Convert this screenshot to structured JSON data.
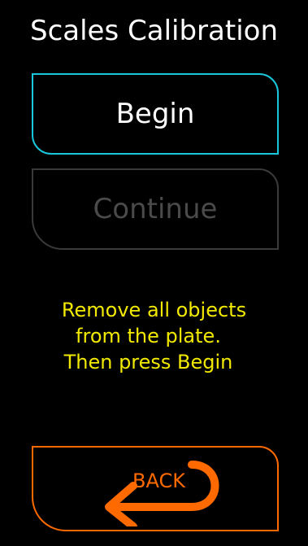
{
  "screen": {
    "title": "Scales Calibration"
  },
  "buttons": {
    "begin_label": "Begin",
    "continue_label": "Continue",
    "back_label": "BACK"
  },
  "instructions": {
    "line1": "Remove all objects",
    "line2": "from the plate.",
    "line3": "Then press Begin"
  },
  "colors": {
    "background": "#000000",
    "begin_border": "#19c6dc",
    "disabled": "#4a4a4a",
    "instruction_text": "#f2e900",
    "back_accent": "#ff6a00"
  },
  "icons": {
    "back": "u-turn-arrow-icon"
  }
}
